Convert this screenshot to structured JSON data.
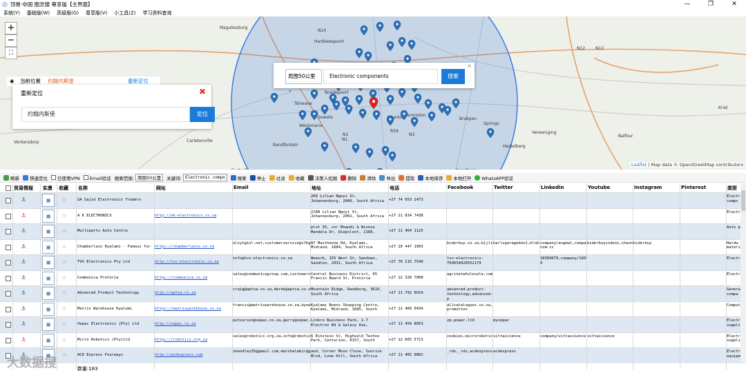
{
  "window": {
    "title": "顶易·中国 图灵搜 尊享版【主界面】",
    "min": "—",
    "max": "❐",
    "close": "✕"
  },
  "menu": [
    "系统(Y)",
    "基础版(W)",
    "高级版(G)",
    "尊享版(V)",
    "小工具(Z)",
    "学习资料查询"
  ],
  "map": {
    "zoom_in": "+",
    "zoom_out": "−",
    "fullscreen": "⛶",
    "labels": [
      "Magaliesburg",
      "Hartbeespoort",
      "N14",
      "N12",
      "N12",
      "Roodepoort",
      "Soweto",
      "N1",
      "Tshwane",
      "Germiston",
      "Brakpan",
      "Springs",
      "Vereeniging",
      "Carletonville",
      "Fochville",
      "Westonaria",
      "Krugersdorp",
      "R59",
      "N1",
      "N3",
      "Heidelberg",
      "Sasolburg",
      "Kriel",
      "Balfour",
      "Randfontein",
      "Alberton",
      "Ventersdorp"
    ],
    "attribution_leaflet": "Leaflet",
    "attribution_rest": " | Map data © OpenStreetMap contributors"
  },
  "location_bar": {
    "label": "当前位置",
    "value": "约翰内斯堡",
    "relocate": "重新定位"
  },
  "relocate_popup": {
    "title": "重新定位",
    "input_value": "约翰内斯堡",
    "button": "定位"
  },
  "search_popup": {
    "radius": "周围50公里",
    "keyword": "Electronic components",
    "button": "搜索",
    "close": "×"
  },
  "toolbar": {
    "refresh": "刷新",
    "quick_locate": "快速定位",
    "used_vpn": "已使用VPN",
    "email_verify": "Email验证",
    "search_range_label": "搜索范围:",
    "search_range": "周围50公里",
    "keyword_label": "关键词:",
    "keyword": "Electronic compo",
    "search": "搜索",
    "stop": "停止",
    "filter": "过滤",
    "collect": "收藏",
    "decision_maker": "决策人挖掘",
    "delete": "删除",
    "clear": "清除",
    "export": "导出",
    "extract": "提取",
    "local_save": "本地保存",
    "local_open": "本地打开",
    "whatsapp": "WhatsAPP验证"
  },
  "columns": [
    "贸易情报",
    "实景",
    "收藏",
    "名称",
    "网址",
    "Email",
    "地址",
    "电话",
    "Facebook",
    "Twitter",
    "Linkedin",
    "Youtube",
    "Instagram",
    "Pinterest",
    "类型"
  ],
  "rows": [
    {
      "name": "SA Sajid Electronics Traders",
      "url": "",
      "email": "",
      "address": "209 Lilian Ngoyi St, Johannesburg, 2000, South Africa",
      "phone": "+27 74 053 2473",
      "fb": "",
      "tw": "",
      "li": "",
      "yt": "",
      "ig": "",
      "pt": "",
      "type": "Electr compo"
    },
    {
      "name": "A K ELECTRONICS",
      "url": "http://ak-electronics.co.za",
      "email": "",
      "address": "216B Lilian Ngoyi St, Johannesburg, 2001, South Africa",
      "phone": "+27 11 834 7438",
      "fb": "",
      "tw": "",
      "li": "",
      "yt": "",
      "ig": "",
      "pt": "",
      "type": "Electr"
    },
    {
      "name": "Multiparts Auto Centre",
      "url": "",
      "email": "",
      "address": "plot 35, cnr Mnandi & Winnie Mandela Dr, Diepsloot, 2189,",
      "phone": "+27 11 464 1125",
      "fb": "",
      "tw": "",
      "li": "",
      "yt": "",
      "ig": "",
      "pt": "",
      "type": "Auto p"
    },
    {
      "name": "Chamberlain Kyalami - Famous for Hardware since 1903",
      "url": "https://chamberlains.co.za",
      "email": "elsyt@iol.net,customerservice@ifbglobal.com,info@chamberlain.c",
      "address": "87 Maxtheone Rd, Kyalami, Midrand, 1684, South Africa",
      "phone": "+27 10 447 1903",
      "fb": "biderbuy.co.za,bijlibachan,catalogueap",
      "tw": "karlsgaragedoo1,blnkoomkw,dasplonm,ub",
      "li": "company/engmat,company/linkedin-com-cc",
      "yt": "biderbuyvideos,channel/ucpcs_DE0OQavab",
      "ig": "biderbuy",
      "pt": "",
      "type": "Hardw materi"
    },
    {
      "name": "TVV Electronics Pty Ltd",
      "url": "http://tvv-electronics.co.za",
      "email": "info@tvv-electronics.co.za",
      "address": "Weeorb, 155 West St, Sandown, Sandton, 2031, South Africa",
      "phone": "+27 76 115 7540",
      "fb": "tvv-electronics-769654026552179",
      "tw": "",
      "li": "18309679,company/1830967 9",
      "yt": "",
      "ig": "",
      "pt": "",
      "type": "Electr"
    },
    {
      "name": "Communica Pretoria",
      "url": "https://communica.co.za",
      "email": "sales@communicagroup.com,customercare@communicagroup.com,logisti",
      "address": "Central Business District, 65 Francis Baard St, Pretoria",
      "phone": "+27 12 328 7008",
      "fb": "agrinetwholesale,communicasouthafrica",
      "tw": "",
      "li": "",
      "yt": "",
      "ig": "",
      "pt": "",
      "type": "Electr"
    },
    {
      "name": "Advanced Product Technology",
      "url": "http://aptsa.co.za",
      "email": "craig@aptsa.co.za,derek@aptsa.co.za,gary@aptsa.co.za,jbk@aptsa.co.za",
      "address": "Mountain Ridge, Randburg, 3610, South Africa",
      "phone": "+27 11 792 6010",
      "fb": "advanced-product-technology,advanced-p",
      "tw": "",
      "li": "",
      "yt": "",
      "ig": "",
      "pt": "",
      "type": "Genera compa"
    },
    {
      "name": "Matrix Warehouse Kyalami",
      "url": "https://matrixwarehouse.co.za",
      "email": "francis@matrixwarehouse.co.za,byoeklym@matrixwarehouse.co.za,bed",
      "address": "Kyalami Boens Shopping Centre, Kyalami, Midrand, 1685, South",
      "phone": "+27 11 466 0434",
      "fb": "allcatalogues.co.za,branders-promotion",
      "tw": "",
      "li": "",
      "yt": "",
      "ig": "",
      "pt": "",
      "type": "Comput"
    },
    {
      "name": "Vepac Electronics (Pty) Ltd",
      "url": "http://vepac.co.za",
      "email": "putourson@vepac.co.za,garry@vepac.co.za,john.smith@vepac.co.za,i",
      "address": "Linbro Business Park, 1-7 Electron Rd & Galaxy Ave,",
      "phone": "+27 11 454 8053",
      "fb": "zp.power.ltd",
      "tw": "myvepac",
      "li": "",
      "yt": "",
      "ig": "",
      "pt": "",
      "type": "Electr suppli"
    },
    {
      "name": "Micro Robotics (Pty)Ltd",
      "url": "https://robotics.org.za",
      "email": "sales@robotics.org.za,info@robotics.org.za,24m42.5a,contactwitt",
      "address": "6 Einstein St, Highveld Techno Park, Centurion, 0157, South",
      "phone": "+27 12 665 5713",
      "fb": "cookies,microrobotics,microrobotics,bl",
      "tw": "vittascience",
      "li": "company/vittascience",
      "yt": "vittascience",
      "ig": "",
      "pt": "",
      "type": "Electr suppli"
    },
    {
      "name": "ACD Express Fourways",
      "url": "http://acdexpress.com",
      "email": "imoodley35@gmail.com,marshalabir@gmail.com,thabo.kgovane@gmail",
      "address": "and, Corner Moon Close, Sunrise Blvd, Lone Hill, South Africa",
      "phone": "+27 11 465 9802",
      "fb": "_rdx,_rdx,acdexpress.plugins",
      "tw": "acdexpress",
      "li": "",
      "yt": "",
      "ig": "",
      "pt": "",
      "type": "Electr equipm"
    }
  ],
  "footer": {
    "count": "数量:183",
    "watermark": "大数据搜"
  },
  "colors": {
    "accent": "#1a7bd8",
    "pin": "#2d6fb7",
    "active_pin": "#e02020",
    "circle": "#3b7be0",
    "row_alt": "#dde8f3"
  }
}
